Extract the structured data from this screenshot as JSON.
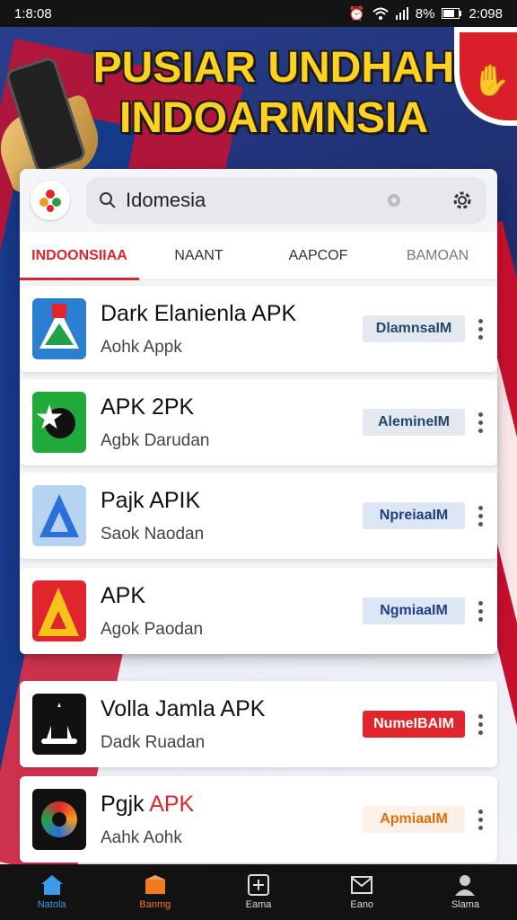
{
  "status_bar": {
    "time": "1:8:08",
    "battery_text": "8%",
    "right_time": "2:098"
  },
  "banner": {
    "title_line1": "PUSIAR UNDHAH",
    "title_line2": "INDOARMNSIA"
  },
  "search": {
    "query": "Idomesia"
  },
  "tabs": [
    {
      "label": "INDOONSIIAA",
      "active": true
    },
    {
      "label": "NAANT",
      "active": false
    },
    {
      "label": "AAPCOF",
      "active": false
    },
    {
      "label": "BAMOAN",
      "active": false
    }
  ],
  "apps": [
    {
      "name": "Dark Elanienla APK",
      "sub": "Aohk  Appk",
      "button": "DlamnsaIM",
      "button_style": "gray",
      "icon": "trophy-apk-icon"
    },
    {
      "name": "APK 2PK",
      "sub": "Agbk  Darudan",
      "button": "AlemineIM",
      "button_style": "gray",
      "icon": "green-star-apk-icon"
    },
    {
      "name": "Pajk APIK",
      "sub": "Saok  Naodan",
      "button": "NpreiaaIM",
      "button_style": "blue",
      "icon": "blue-triangle-apk-icon"
    },
    {
      "name": "APK",
      "sub": "Agok  Paodan",
      "button": "NgmiaaIM",
      "button_style": "blue",
      "icon": "red-triangle-apk-icon"
    },
    {
      "name": "Volla Jamla APK",
      "sub": "Dadk  Ruadan",
      "button": "NumeIBAIM",
      "button_style": "red",
      "icon": "black-a-apk-icon"
    },
    {
      "name_plain": "Pgjk ",
      "name_red": "APK",
      "sub": "Aahk  Aohk",
      "button": "ApmiaaIM",
      "button_style": "orange",
      "icon": "swirl-apk-icon"
    }
  ],
  "bottom_nav": [
    {
      "label": "Natola",
      "icon": "home-icon"
    },
    {
      "label": "Banmg",
      "icon": "store-icon"
    },
    {
      "label": "Eama",
      "icon": "add-box-icon"
    },
    {
      "label": "Eano",
      "icon": "mail-icon"
    },
    {
      "label": "Slama",
      "icon": "profile-icon"
    }
  ],
  "colors": {
    "accent_red": "#d8262c",
    "nav_home": "#3a9be8",
    "nav_active": "#f07b20"
  }
}
